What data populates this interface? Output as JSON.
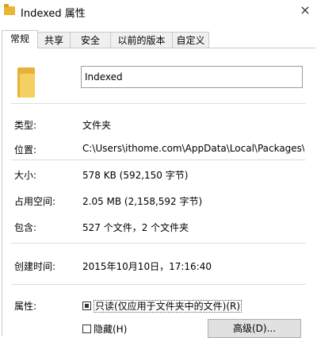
{
  "window": {
    "title": "Indexed 属性",
    "close_glyph": "×"
  },
  "tabs": [
    {
      "label": "常规",
      "active": true
    },
    {
      "label": "共享",
      "active": false
    },
    {
      "label": "安全",
      "active": false
    },
    {
      "label": "以前的版本",
      "active": false
    },
    {
      "label": "自定义",
      "active": false
    }
  ],
  "general": {
    "folder_name": "Indexed",
    "type_label": "类型:",
    "type_value": "文件夹",
    "location_label": "位置:",
    "location_value": "C:\\Users\\ithome.com\\AppData\\Local\\Packages\\w",
    "size_label": "大小:",
    "size_value": "578 KB (592,150 字节)",
    "disk_size_label": "占用空间:",
    "disk_size_value": "2.05 MB (2,158,592 字节)",
    "contains_label": "包含:",
    "contains_value": "527 个文件，2 个文件夹",
    "created_label": "创建时间:",
    "created_value": "2015年10月10日，17:16:40",
    "attributes_label": "属性:",
    "readonly_label": "只读(仅应用于文件夹中的文件)(R)",
    "hidden_label": "隐藏(H)",
    "advanced_button": "高级(D)..."
  },
  "colors": {
    "folder_icon": "#f5cf62",
    "tab_border": "#c9c9c9"
  }
}
